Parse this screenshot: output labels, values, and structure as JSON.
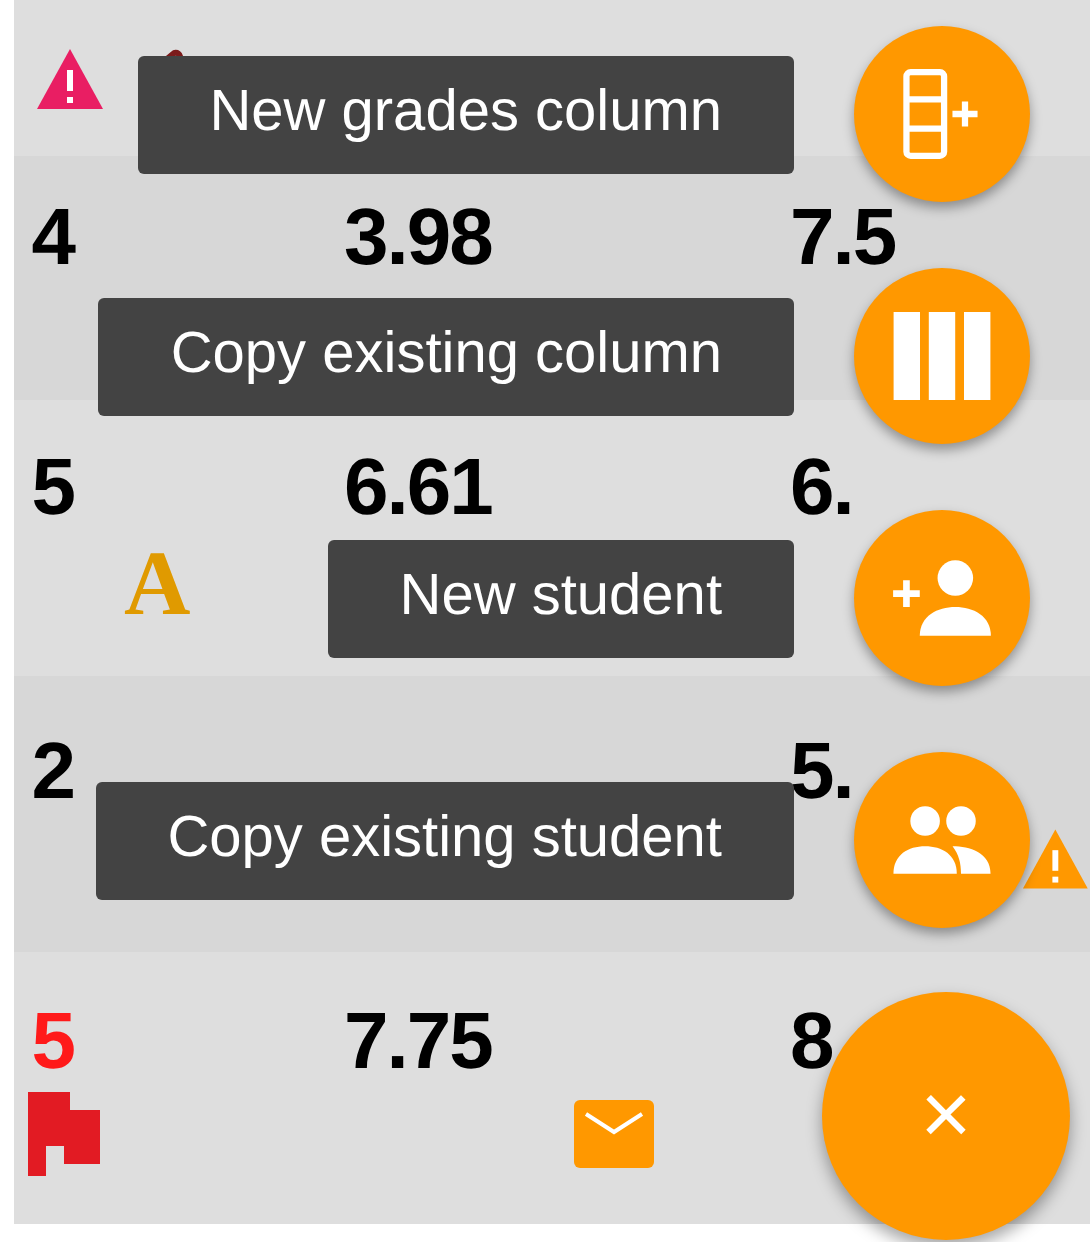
{
  "grades_table": {
    "rows": [
      {
        "cells": []
      },
      {
        "cells": [
          {
            "text": "4",
            "kind": "normal"
          },
          {
            "text": "3.98",
            "kind": "normal"
          },
          {
            "text": "7.5",
            "kind": "normal"
          }
        ]
      },
      {
        "cells": [
          {
            "text": "5",
            "kind": "normal"
          },
          {
            "text": "6.61",
            "kind": "normal"
          },
          {
            "text": "6.",
            "kind": "normal"
          }
        ],
        "letters": [
          "A"
        ]
      },
      {
        "cells": [
          {
            "text": "2",
            "kind": "normal"
          },
          {
            "kind": "hidden"
          },
          {
            "text": "5.",
            "kind": "normal"
          }
        ]
      },
      {
        "cells": [
          {
            "text": "5",
            "kind": "alert"
          },
          {
            "text": "7.75",
            "kind": "normal"
          },
          {
            "text": "8",
            "kind": "normal"
          }
        ]
      }
    ]
  },
  "fab_menu": {
    "actions": [
      {
        "label": "New grades column",
        "kind": "new_column"
      },
      {
        "label": "Copy existing column",
        "kind": "copy_column"
      },
      {
        "label": "New student",
        "kind": "new_student"
      },
      {
        "label": "Copy existing student",
        "kind": "copy_student"
      }
    ],
    "close": "×"
  }
}
